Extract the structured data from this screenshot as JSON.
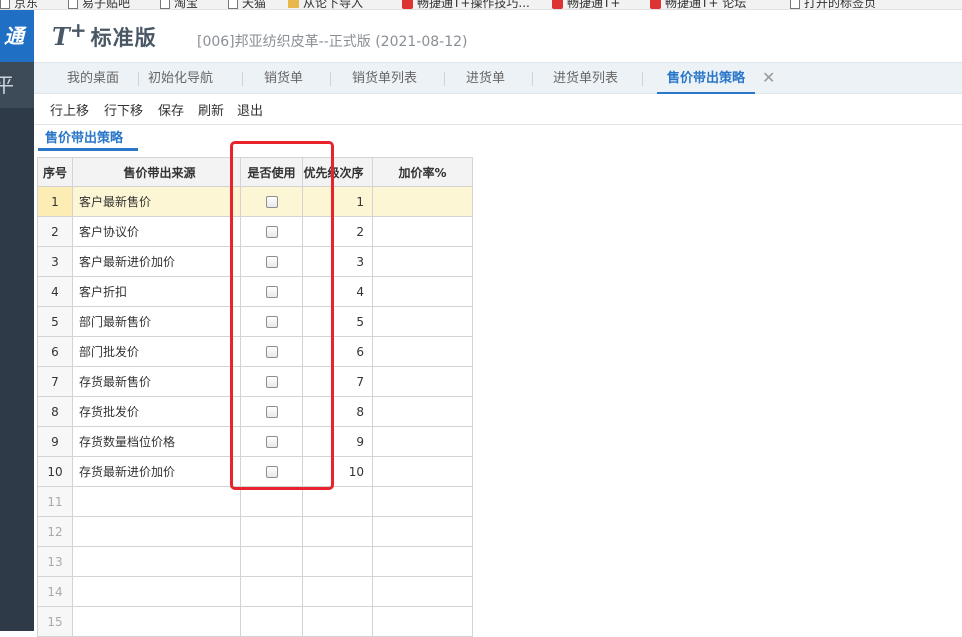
{
  "browser": {
    "bookmarks": [
      {
        "label": "京东",
        "icon": "page-icon"
      },
      {
        "label": "易子贴吧",
        "icon": "page-icon"
      },
      {
        "label": "淘宝",
        "icon": "page-icon"
      },
      {
        "label": "天猫",
        "icon": "page-icon"
      },
      {
        "label": "从论下导入",
        "icon": "folder-icon"
      },
      {
        "label": "畅捷通T+操作技巧...",
        "icon": "brand-icon"
      },
      {
        "label": "畅捷通T+",
        "icon": "brand-icon"
      },
      {
        "label": "畅捷通T+ 论坛",
        "icon": "brand-icon"
      },
      {
        "label": "打开的标签页",
        "icon": "page-icon"
      }
    ]
  },
  "sidebar": {
    "logo_text": "通",
    "item_text": "平"
  },
  "header": {
    "brand_t": "T",
    "brand_plus": "+",
    "brand_name": "标准版",
    "company": "[006]邦亚纺织皮革--正式版  (2021-08-12)"
  },
  "tabs": [
    {
      "label": "我的桌面"
    },
    {
      "label": "初始化导航"
    },
    {
      "label": "销货单"
    },
    {
      "label": "销货单列表"
    },
    {
      "label": "进货单"
    },
    {
      "label": "进货单列表"
    },
    {
      "label": "售价带出策略",
      "active": true
    }
  ],
  "tab_close_symbol": "✕",
  "toolbar": {
    "move_up": "行上移",
    "move_down": "行下移",
    "save": "保存",
    "refresh": "刷新",
    "exit": "退出"
  },
  "section": {
    "title": "售价带出策略"
  },
  "grid": {
    "columns": {
      "idx": "序号",
      "source": "售价带出来源",
      "use": "是否使用",
      "priority": "优先级次序",
      "rate": "加价率%"
    },
    "rows": [
      {
        "idx": "1",
        "source": "客户最新售价",
        "use": false,
        "priority": "1",
        "rate": ""
      },
      {
        "idx": "2",
        "source": "客户协议价",
        "use": false,
        "priority": "2",
        "rate": ""
      },
      {
        "idx": "3",
        "source": "客户最新进价加价",
        "use": false,
        "priority": "3",
        "rate": ""
      },
      {
        "idx": "4",
        "source": "客户折扣",
        "use": false,
        "priority": "4",
        "rate": ""
      },
      {
        "idx": "5",
        "source": "部门最新售价",
        "use": false,
        "priority": "5",
        "rate": ""
      },
      {
        "idx": "6",
        "source": "部门批发价",
        "use": false,
        "priority": "6",
        "rate": ""
      },
      {
        "idx": "7",
        "source": "存货最新售价",
        "use": false,
        "priority": "7",
        "rate": ""
      },
      {
        "idx": "8",
        "source": "存货批发价",
        "use": false,
        "priority": "8",
        "rate": ""
      },
      {
        "idx": "9",
        "source": "存货数量档位价格",
        "use": false,
        "priority": "9",
        "rate": ""
      },
      {
        "idx": "10",
        "source": "存货最新进价加价",
        "use": false,
        "priority": "10",
        "rate": ""
      }
    ],
    "empty_rows": [
      "11",
      "12",
      "13",
      "14",
      "15"
    ]
  },
  "colors": {
    "accent": "#2a76c8",
    "sidebar": "#2e3a47",
    "selected_row": "#fdf6d4",
    "highlight_box": "#e8232b"
  }
}
